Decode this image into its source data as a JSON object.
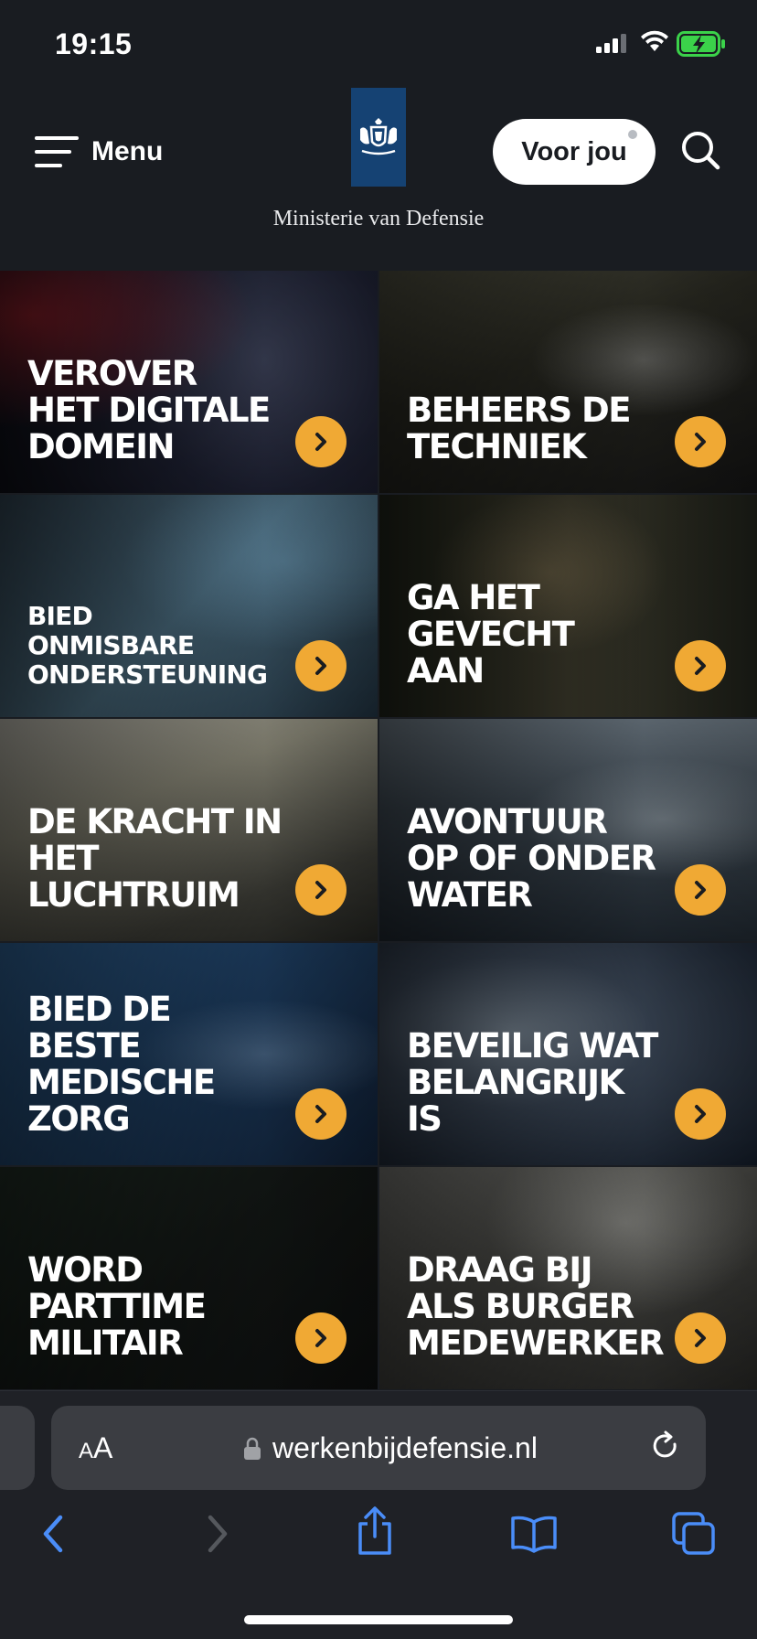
{
  "status_bar": {
    "time": "19:15"
  },
  "header": {
    "menu_label": "Menu",
    "ministry": "Ministerie van Defensie",
    "voor_jou_label": "Voor jou"
  },
  "tiles": [
    {
      "title": "Verover\nhet digitale\ndomein"
    },
    {
      "title": "Beheers de\ntechniek"
    },
    {
      "title": "Bied\nonmisbare\nondersteuning"
    },
    {
      "title": "Ga het\ngevecht\naan"
    },
    {
      "title": "De kracht in\nhet\nluchtruim"
    },
    {
      "title": "Avontuur\nop of onder\nwater"
    },
    {
      "title": "Bied de\nbeste\nmedische\nzorg"
    },
    {
      "title": "Beveilig wat\nbelangrijk\nis"
    },
    {
      "title": "Word\nparttime\nmilitair"
    },
    {
      "title": "Draag bij\nals burger\nmedewerker"
    }
  ],
  "browser": {
    "aa_label_big": "A",
    "aa_label_small": "A",
    "url": "werkenbijdefensie.nl"
  },
  "colors": {
    "accent": "#f0a934",
    "logo_blue": "#154273",
    "ios_blue": "#4a8df8"
  }
}
